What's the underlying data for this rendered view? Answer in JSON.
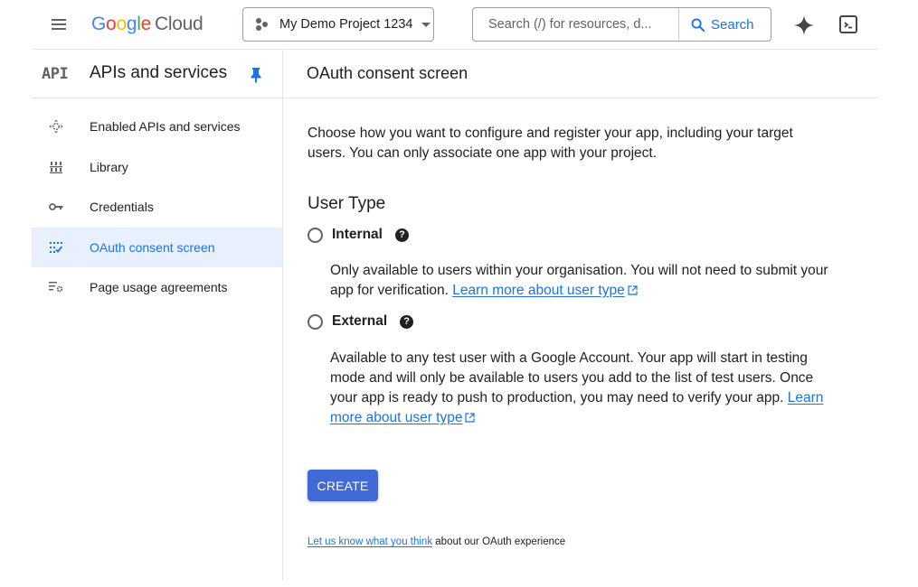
{
  "header": {
    "menu_icon": "hamburger-menu-icon",
    "logo": {
      "google": [
        "G",
        "o",
        "o",
        "g",
        "l",
        "e"
      ],
      "product": "Cloud"
    },
    "project_picker": {
      "icon": "project-hub-icon",
      "value": "My Demo Project 1234",
      "caret": "dropdown-caret-icon"
    },
    "search": {
      "placeholder": "Search (/) for resources, d...",
      "button_label": "Search",
      "icon": "search-icon"
    },
    "gemini_icon": "gemini-sparkle-icon",
    "cloud_shell_icon": "cloud-shell-terminal-icon"
  },
  "subheader": {
    "api_logo": "API",
    "section_title": "APIs and services",
    "pin_icon": "pin-icon",
    "page_title": "OAuth consent screen"
  },
  "sidebar": {
    "items": [
      {
        "label": "Enabled APIs and services",
        "icon": "enabled-apis-icon",
        "active": false
      },
      {
        "label": "Library",
        "icon": "library-icon",
        "active": false
      },
      {
        "label": "Credentials",
        "icon": "key-icon",
        "active": false
      },
      {
        "label": "OAuth consent screen",
        "icon": "oauth-consent-icon",
        "active": true
      },
      {
        "label": "Page usage agreements",
        "icon": "page-usage-settings-icon",
        "active": false
      }
    ]
  },
  "main": {
    "intro": "Choose how you want to configure and register your app, including your target users. You can only associate one app with your project.",
    "user_type_heading": "User Type",
    "options": [
      {
        "label": "Internal",
        "selected": false,
        "help": "?",
        "description": "Only available to users within your organisation. You will not need to submit your app for verification.",
        "link": "Learn more about user type"
      },
      {
        "label": "External",
        "selected": false,
        "help": "?",
        "description": "Available to any test user with a Google Account. Your app will start in testing mode and will only be available to users you add to the list of test users. Once your app is ready to push to production, you may need to verify your app.",
        "link": "Learn more about user type"
      }
    ],
    "create_button": "CREATE",
    "feedback": {
      "link": "Let us know what you think",
      "text": " about our OAuth experience"
    }
  },
  "colors": {
    "accent": "#1a73e8",
    "primary_button": "#3f6ad8",
    "active_nav_bg": "#e8f0fe",
    "divider": "#e6e6e6"
  }
}
